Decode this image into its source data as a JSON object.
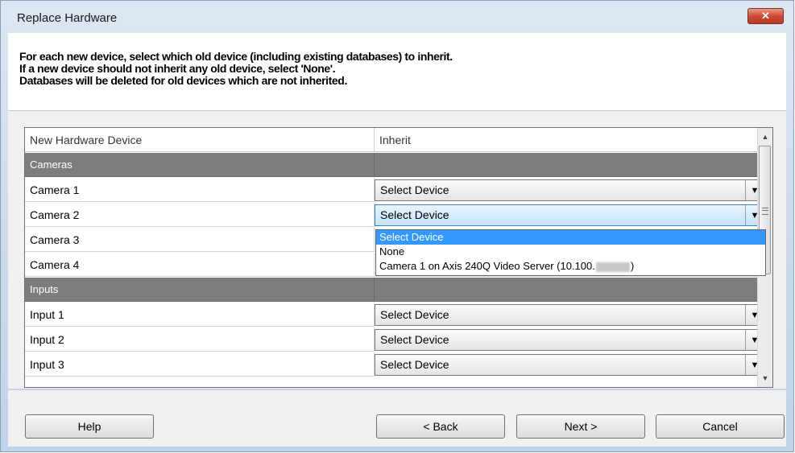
{
  "window": {
    "title": "Replace Hardware",
    "close_label": "✕"
  },
  "instructions": [
    "For each new device, select which old device (including existing databases) to inherit.",
    "If a new device should not inherit any old device, select 'None'.",
    "Databases will be deleted for old devices which are not inherited."
  ],
  "grid": {
    "columns": [
      "New Hardware Device",
      "Inherit"
    ],
    "groups": [
      {
        "name": "Cameras",
        "rows": [
          {
            "device": "Camera 1",
            "inherit": "Select Device"
          },
          {
            "device": "Camera 2",
            "inherit": "Select Device"
          },
          {
            "device": "Camera 3",
            "inherit": ""
          },
          {
            "device": "Camera 4",
            "inherit": ""
          }
        ]
      },
      {
        "name": "Inputs",
        "rows": [
          {
            "device": "Input 1",
            "inherit": "Select Device"
          },
          {
            "device": "Input 2",
            "inherit": "Select Device"
          },
          {
            "device": "Input 3",
            "inherit": "Select Device"
          }
        ]
      }
    ]
  },
  "dropdown": {
    "options": [
      "Select Device",
      "None",
      "Camera 1 on Axis 240Q Video Server (10.100."
    ],
    "option3_suffix": ")",
    "selected": "Select Device"
  },
  "footer": {
    "help": "Help",
    "back": "< Back",
    "next": "Next >",
    "cancel": "Cancel"
  }
}
